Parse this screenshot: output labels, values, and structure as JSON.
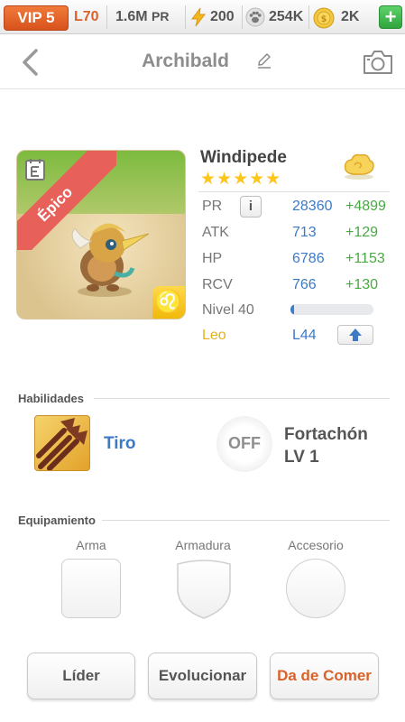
{
  "topbar": {
    "vip": "VIP 5",
    "level": "L70",
    "power": "1.6M",
    "power_unit": "PR",
    "energy": "200",
    "paws": "254K",
    "coins": "2K",
    "add_label": "+"
  },
  "nav": {
    "title": "Archibald"
  },
  "monster": {
    "rarity": "Épico",
    "name": "Windipede",
    "stars": "★★★★★",
    "zodiac_symbol": "♌",
    "stats": [
      {
        "label": "PR",
        "value": "28360",
        "bonus": "+4899"
      },
      {
        "label": "ATK",
        "value": "713",
        "bonus": "+129"
      },
      {
        "label": "HP",
        "value": "6786",
        "bonus": "+1153"
      },
      {
        "label": "RCV",
        "value": "766",
        "bonus": "+130"
      }
    ],
    "info_label": "i",
    "level_label": "Nivel 40",
    "level_progress": 0.04,
    "sign_label": "Leo",
    "sign_level": "L44"
  },
  "skills": {
    "heading": "Habilidades",
    "primary": "Tiro",
    "secondary_state": "OFF",
    "secondary_name": "Fortachón",
    "secondary_level": "LV 1"
  },
  "equipment": {
    "heading": "Equipamiento",
    "slots": [
      "Arma",
      "Armadura",
      "Accesorio"
    ]
  },
  "actions": {
    "leader": "Líder",
    "evolve": "Evolucionar",
    "feed": "Da de Comer"
  },
  "colors": {
    "accent_orange": "#d9622a",
    "stat_blue": "#3c7ac6",
    "bonus_green": "#49a942",
    "star_gold": "#ffc619",
    "ribbon_red": "#e8605a"
  }
}
